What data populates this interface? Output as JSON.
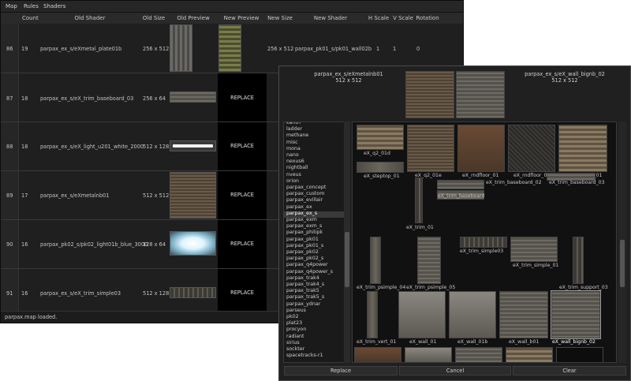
{
  "menu": [
    "Map",
    "Rules",
    "Shaders"
  ],
  "columns": [
    "Count",
    "Old Shader",
    "Old Size",
    "Old Preview",
    "New Preview",
    "New Size",
    "New Shader",
    "H Scale",
    "V Scale",
    "Rotation"
  ],
  "rows": [
    {
      "index": "86",
      "count": "19",
      "old_shader": "parpax_ex_s/eXmetal_plate01b",
      "old_size": "256 x 512",
      "new_preview": "",
      "new_size": "256 x 512",
      "new_shader": "parpax_pk01_s/pk01_wall02b",
      "h_scale": "1",
      "v_scale": "1",
      "rotation": "0"
    },
    {
      "index": "87",
      "count": "18",
      "old_shader": "parpax_ex_s/eX_trim_baseboard_03",
      "old_size": "256 x 64",
      "new_preview": "REPLACE",
      "new_size": "",
      "new_shader": "",
      "h_scale": "",
      "v_scale": "",
      "rotation": ""
    },
    {
      "index": "88",
      "count": "18",
      "old_shader": "parpax_ex_s/eX_light_u201_white_2000",
      "old_size": "512 x 128",
      "new_preview": "REPLACE",
      "new_size": "",
      "new_shader": "",
      "h_scale": "",
      "v_scale": "",
      "rotation": ""
    },
    {
      "index": "89",
      "count": "17",
      "old_shader": "parpax_ex_s/eXmetalnb01",
      "old_size": "512 x 512",
      "new_preview": "REPLACE",
      "new_size": "",
      "new_shader": "",
      "h_scale": "",
      "v_scale": "",
      "rotation": ""
    },
    {
      "index": "90",
      "count": "16",
      "old_shader": "parpax_pk02_s/pk02_light01b_blue_3000",
      "old_size": "128 x 64",
      "new_preview": "REPLACE",
      "new_size": "",
      "new_shader": "",
      "h_scale": "",
      "v_scale": "",
      "rotation": ""
    },
    {
      "index": "91",
      "count": "16",
      "old_shader": "parpax_ex_s/eX_trim_simple03",
      "old_size": "512 x 128",
      "new_preview": "REPLACE",
      "new_size": "",
      "new_shader": "",
      "h_scale": "",
      "v_scale": "",
      "rotation": ""
    }
  ],
  "status": "parpax.map loaded.",
  "dialog": {
    "left_name": "parpax_ex_s/eXmetalnb01",
    "left_size": "512 x 512",
    "right_name": "parpax_ex_s/eX_wall_bignb_02",
    "right_size": "512 x 512",
    "list_items": [
      "kanth",
      "ladder",
      "methane",
      "misc",
      "mona",
      "nano",
      "nexus6",
      "nightball",
      "nveus",
      "orion",
      "parpax_concept",
      "parpax_custom",
      "parpax_evillair",
      "parpax_ex",
      "parpax_ex_s",
      "parpax_exm",
      "parpax_exm_s",
      "parpax_philipk",
      "parpax_pk01",
      "parpax_pk01_s",
      "parpax_pk02",
      "parpax_pk02_s",
      "parpax_q4power",
      "parpax_q4power_s",
      "parpax_trak4",
      "parpax_trak4_s",
      "parpax_trak5",
      "parpax_trak5_s",
      "parpax_ydnar",
      "parseus",
      "pk02",
      "plat23",
      "procyon",
      "radiant",
      "sirius",
      "sockter",
      "spacetracks-r1"
    ],
    "selected_item": "parpax_ex_s",
    "textures": [
      "eX_q2_01d",
      "eX_q2_01e",
      "eX_rndfloor_01",
      "eX_rndfloor_02",
      "eX_rplates_01",
      "eX_steptop_01",
      "eX_trim_baseboard_02",
      "eX_trim_baseboard_03",
      "eX_trim_baseboard",
      "eX_trim_01",
      "eX_trim_simple03",
      "eX_trim_simple_01",
      "eX_trim_psimple_04",
      "eX_trim_psimple_05",
      "eX_trim_support_03",
      "eX_trim_vert_01",
      "eX_wall_01",
      "eX_wall_01b",
      "eX_wall_b01",
      "eX_wall_bignb_02"
    ],
    "buttons": {
      "replace": "Replace",
      "cancel": "Cancel",
      "clear": "Clear"
    }
  }
}
